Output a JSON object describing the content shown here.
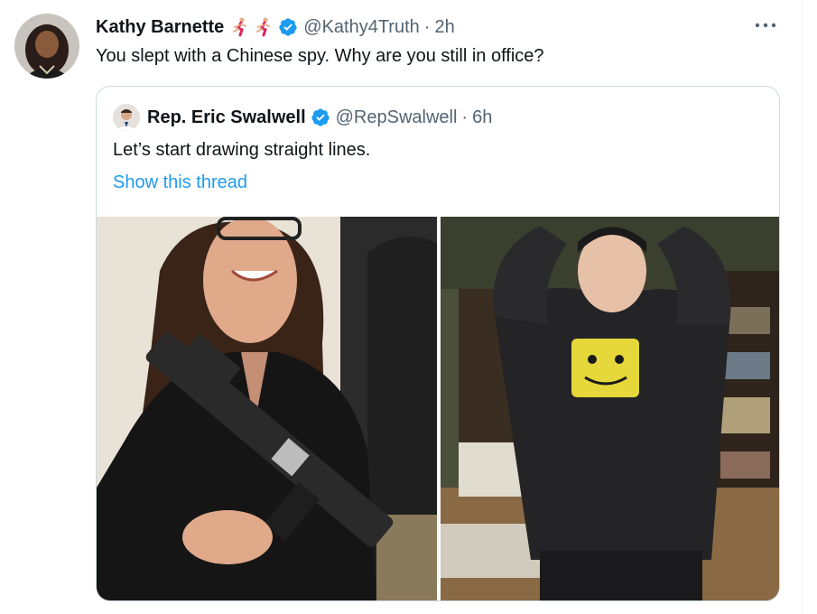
{
  "tweet": {
    "author": {
      "display_name": "Kathy Barnette",
      "emoji": [
        "🏃‍♀️",
        "🏃‍♀️"
      ],
      "handle": "@Kathy4Truth",
      "verified": true,
      "avatar_icon": "user-avatar-photo"
    },
    "separator": "·",
    "time": "2h",
    "text": "You slept with a Chinese spy. Why are you still in office?",
    "more_icon": "more-dots-icon"
  },
  "quoted_tweet": {
    "author": {
      "display_name": "Rep. Eric Swalwell",
      "handle": "@RepSwalwell",
      "verified": true,
      "avatar_icon": "user-avatar-photo"
    },
    "separator": "·",
    "time": "6h",
    "text": "Let’s start drawing straight lines.",
    "show_thread": "Show this thread",
    "media": [
      {
        "icon": "photo-woman-with-rifle"
      },
      {
        "icon": "photo-young-man-in-hoodie"
      }
    ]
  },
  "colors": {
    "text_primary": "#0f1419",
    "text_secondary": "#536471",
    "link": "#1d9bf0",
    "verified": "#1d9bf0",
    "border": "#cfd9de"
  }
}
